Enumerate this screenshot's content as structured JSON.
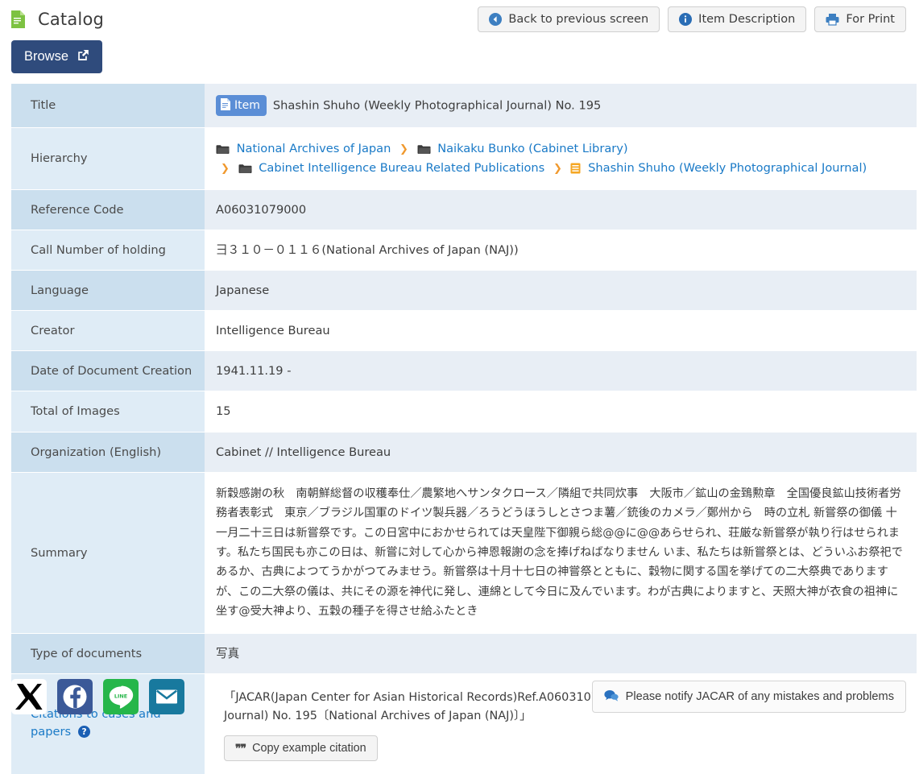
{
  "header": {
    "title": "Catalog",
    "doc_icon": "document-green-icon",
    "browse_label": "Browse",
    "browse_icon": "external-link-icon",
    "actions": [
      {
        "label": "Back to previous screen",
        "icon": "back-circle-icon"
      },
      {
        "label": "Item Description",
        "icon": "info-circle-icon"
      },
      {
        "label": "For Print",
        "icon": "printer-icon"
      }
    ]
  },
  "colors": {
    "accent_blue": "#1a7ac7",
    "browse_navy": "#2f4b7c",
    "badge_blue": "#5b8ed6",
    "label_dark": "#cbdfee",
    "label_light": "#dfecf6",
    "value_tint": "#e8eef5",
    "chevron_orange": "#f0992e",
    "green_icon": "#7dc242"
  },
  "rows": {
    "title_label": "Title",
    "title_badge": "Item",
    "title_value": "Shashin Shuho (Weekly Photographical Journal) No. 195",
    "hierarchy_label": "Hierarchy",
    "hierarchy_nodes": [
      {
        "label": "National Archives of Japan",
        "icon": "folder-icon"
      },
      {
        "label": "Naikaku Bunko (Cabinet Library)",
        "icon": "folder-icon"
      },
      {
        "label": "Cabinet Intelligence Bureau Related Publications",
        "icon": "folder-icon"
      },
      {
        "label": "Shashin Shuho (Weekly Photographical Journal)",
        "icon": "file-list-orange-icon"
      }
    ],
    "hierarchy_separator": "❯",
    "reference_code_label": "Reference Code",
    "reference_code_value": "A06031079000",
    "call_number_label": "Call Number of holding",
    "call_number_value": "彐３１０－０１１６(National Archives of Japan (NAJ))",
    "language_label": "Language",
    "language_value": "Japanese",
    "creator_label": "Creator",
    "creator_value": "Intelligence Bureau",
    "date_label": "Date of Document Creation",
    "date_value": "1941.11.19 -",
    "total_images_label": "Total of Images",
    "total_images_value": "15",
    "organization_label": "Organization (English)",
    "organization_value": "Cabinet // Intelligence Bureau",
    "summary_label": "Summary",
    "summary_value": "新穀感謝の秋　南朝鮮総督の収穫奉仕／農繁地へサンタクロース／隣組で共同炊事　大阪市／鉱山の金鵄勲章　全国優良鉱山技術者労務者表彰式　東京／ブラジル国軍のドイツ製兵器／ろうどうほうしとさつま薯／銃後のカメラ／鄭州から　時の立札 新嘗祭の御儀 十一月二十三日は新嘗祭です。この日宮中におかせられては天皇陛下御親ら総@@に@@あらせられ、荘厳な新嘗祭が執り行はせられます。私たち国民も亦この日は、新嘗に対して心から神恩報謝の念を捧げねばなりません いま、私たちは新嘗祭とは、どういふお祭祀であるか、古典によつてうかがつてみませう。新嘗祭は十月十七日の神嘗祭とともに、穀物に関する国を挙げての二大祭典でありますが、この二大祭の儀は、共にその源を神代に発し、連綿として今日に及んでいます。わが古典によりますと、天照大神が衣食の祖神に坐す@受大神より、五穀の種子を得させ給ふたとき",
    "type_label": "Type of documents",
    "type_value": "写真",
    "citations_label": "Citations to cases and papers",
    "citations_help_icon": "help-circle-icon",
    "citations_value": "「JACAR(Japan Center for Asian Historical Records)Ref.A06031079000、Shashin Shuho (Weekly Photographical Journal) No. 195〔National Archives of Japan (NAJ)〕」",
    "copy_button_label": "Copy example citation",
    "copy_button_icon": "quote-icon"
  },
  "footer": {
    "socials": [
      {
        "name": "x-twitter-icon",
        "color": "#000000"
      },
      {
        "name": "facebook-icon",
        "color": "#3b5998"
      },
      {
        "name": "line-icon",
        "color": "#26b64a"
      },
      {
        "name": "email-icon",
        "color": "#18799e"
      }
    ],
    "notify_label": "Please notify JACAR of any mistakes and problems",
    "notify_icon": "comment-icon"
  }
}
